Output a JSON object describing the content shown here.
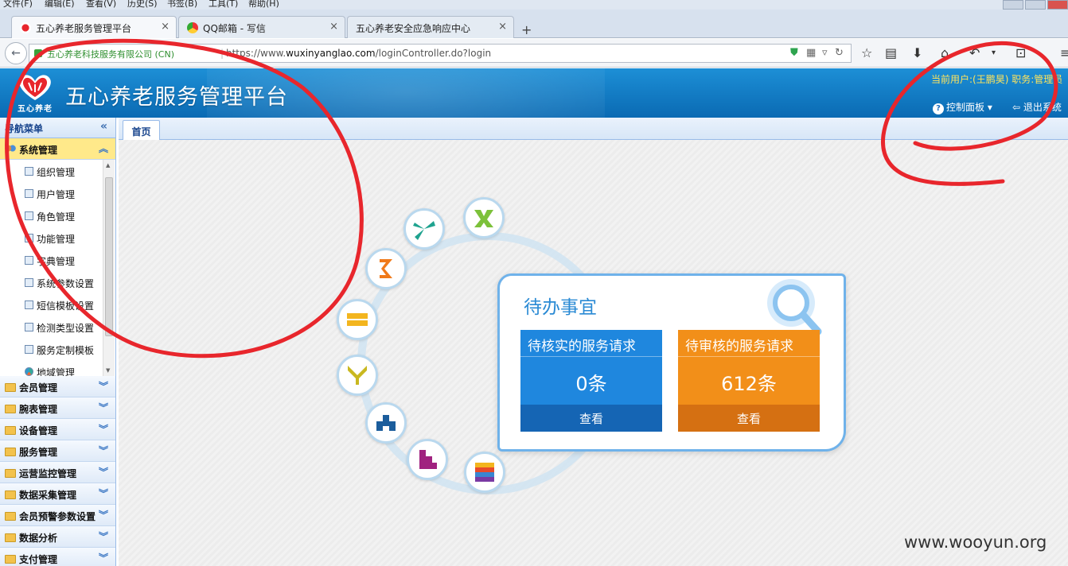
{
  "browser": {
    "menu": [
      "文件(F)",
      "编辑(E)",
      "查看(V)",
      "历史(S)",
      "书签(B)",
      "工具(T)",
      "帮助(H)"
    ],
    "tabs": [
      {
        "label": "五心养老服务管理平台",
        "active": true
      },
      {
        "label": "QQ邮箱 - 写信",
        "active": false
      },
      {
        "label": "五心养老安全应急响应中心",
        "active": false
      }
    ],
    "new_tab": "+",
    "close_glyph": "×",
    "identity": "五心养老科技服务有限公司 (CN)",
    "url_prefix": "https://www.",
    "url_host": "wuxinyanglao.com",
    "url_path": "/loginController.do?login"
  },
  "header": {
    "logo_text": "五心养老",
    "title": "五心养老服务管理平台",
    "user": "当前用户:(王鹏昊) 职务:管理员",
    "control_panel": "控制面板",
    "logout": "退出系统"
  },
  "sidebar": {
    "title": "导航菜单",
    "open_group": "系统管理",
    "sub_items": [
      "组织管理",
      "用户管理",
      "角色管理",
      "功能管理",
      "字典管理",
      "系统参数设置",
      "短信模板设置",
      "检测类型设置",
      "服务定制模板",
      "地域管理"
    ],
    "groups": [
      "会员管理",
      "腕表管理",
      "设备管理",
      "服务管理",
      "运营监控管理",
      "数据采集管理",
      "会员预警参数设置",
      "数据分析",
      "支付管理"
    ]
  },
  "main": {
    "home_tab": "首页",
    "card": {
      "title": "待办事宜",
      "pending_verify": {
        "label": "待核实的服务请求",
        "count": "0条",
        "action": "查看",
        "color": "#1f87de"
      },
      "pending_review": {
        "label": "待审核的服务请求",
        "count": "612条",
        "action": "查看",
        "color": "#f28f19"
      }
    },
    "ring_icons": [
      "yellow-bar-icon",
      "yellow-y-icon",
      "blue-tetris-icon",
      "magenta-puzzle-icon",
      "striped-square-icon",
      "orange-s-icon",
      "teal-fan-icon",
      "green-y-icon"
    ]
  },
  "watermark": "www.wooyun.org",
  "colors": {
    "header": "#0a6ab3",
    "accent": "#2a8ad4",
    "annotation": "#e8262c"
  }
}
